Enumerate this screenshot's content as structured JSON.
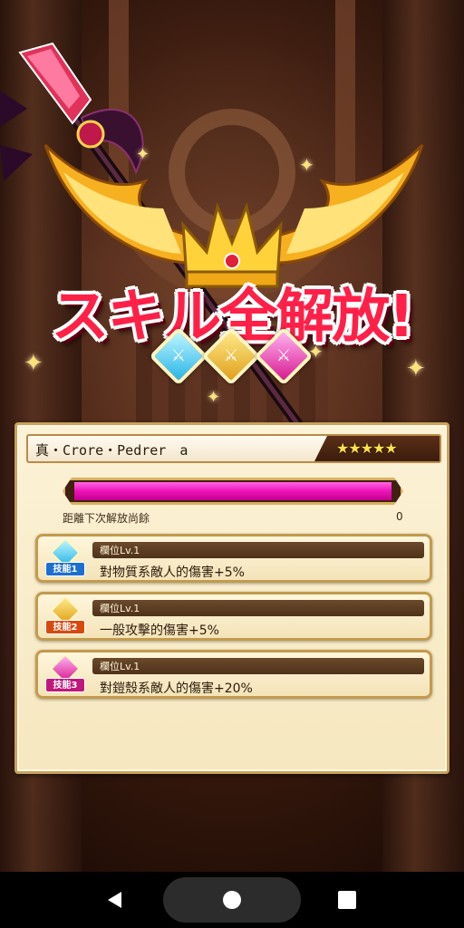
{
  "banner": {
    "title": "スキル全解放!"
  },
  "unit": {
    "name": "真・Crore・Pedrer　a",
    "stars": "★★★★★"
  },
  "gauge": {
    "fill_fraction": 1.0,
    "remain_label": "距離下次解放尚餘",
    "remain_value": "0"
  },
  "skills": [
    {
      "tag": "技能1",
      "level": "欄位Lv.1",
      "desc": "對物質系敵人的傷害+5%"
    },
    {
      "tag": "技能2",
      "level": "欄位Lv.1",
      "desc": "一般攻擊的傷害+5%"
    },
    {
      "tag": "技能3",
      "level": "欄位Lv.1",
      "desc": "對鎧殼系敵人的傷害+20%"
    }
  ],
  "icons": {
    "gem1": "sword-gem-icon",
    "gem2": "sword-gem-icon",
    "gem3": "sword-gem-icon",
    "back": "back-triangle-icon",
    "home": "home-circle-icon",
    "recent": "recent-apps-square-icon"
  },
  "colors": {
    "gauge": "#ee12b8",
    "title": "#ff2048",
    "skill1": "#28b4e6",
    "skill2": "#e0a01a",
    "skill3": "#d8198e"
  }
}
